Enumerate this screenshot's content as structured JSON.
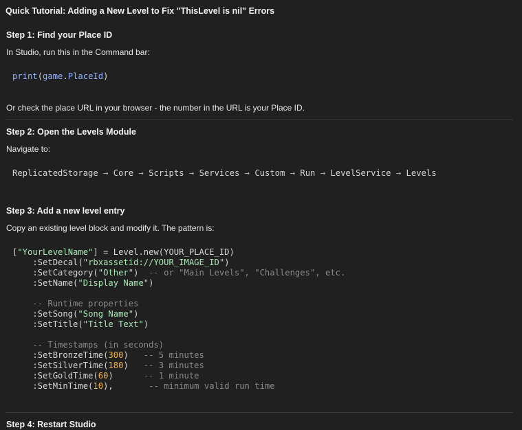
{
  "title": "Quick Tutorial: Adding a New Level to Fix \"ThisLevel is nil\" Errors",
  "step1": {
    "heading": "Step 1: Find your Place ID",
    "intro": "In Studio, run this in the Command bar:",
    "code_fn": "print",
    "code_paren_open": "(",
    "code_arg": "game",
    "code_dot": ".",
    "code_prop": "PlaceId",
    "code_paren_close": ")",
    "note": "Or check the place URL in your browser - the number in the URL is your Place ID."
  },
  "step2": {
    "heading": "Step 2: Open the Levels Module",
    "intro": "Navigate to:",
    "path": [
      "ReplicatedStorage",
      "Core",
      "Scripts",
      "Services",
      "Custom",
      "Run",
      "LevelService",
      "Levels"
    ],
    "arrow": "→"
  },
  "step3": {
    "heading": "Step 3: Add a new level entry",
    "intro": "Copy an existing level block and modify it. The pattern is:",
    "code": {
      "l1_a": "[",
      "l1_str": "\"YourLevelName\"",
      "l1_b": "] = Level.new(YOUR_PLACE_ID)",
      "l2_a": "    :SetDecal(",
      "l2_str": "\"rbxassetid://YOUR_IMAGE_ID\"",
      "l2_b": ")",
      "l3_a": "    :SetCategory(",
      "l3_str": "\"Other\"",
      "l3_b": ")  ",
      "l3_cm": "-- or \"Main Levels\", \"Challenges\", etc.",
      "l4_a": "    :SetName(",
      "l4_str": "\"Display Name\"",
      "l4_b": ")",
      "l6_cm": "    -- Runtime properties",
      "l7_a": "    :SetSong(",
      "l7_str": "\"Song Name\"",
      "l7_b": ")",
      "l8_a": "    :SetTitle(",
      "l8_str": "\"Title Text\"",
      "l8_b": ")",
      "l10_cm": "    -- Timestamps (in seconds)",
      "l11_a": "    :SetBronzeTime(",
      "l11_num": "300",
      "l11_b": ")   ",
      "l11_cm": "-- 5 minutes",
      "l12_a": "    :SetSilverTime(",
      "l12_num": "180",
      "l12_b": ")   ",
      "l12_cm": "-- 3 minutes",
      "l13_a": "    :SetGoldTime(",
      "l13_num": "60",
      "l13_b": ")      ",
      "l13_cm": "-- 1 minute",
      "l14_a": "    :SetMinTime(",
      "l14_num": "10",
      "l14_b": "),       ",
      "l14_cm": "-- minimum valid run time"
    }
  },
  "step4": {
    "heading": "Step 4: Restart Studio"
  }
}
